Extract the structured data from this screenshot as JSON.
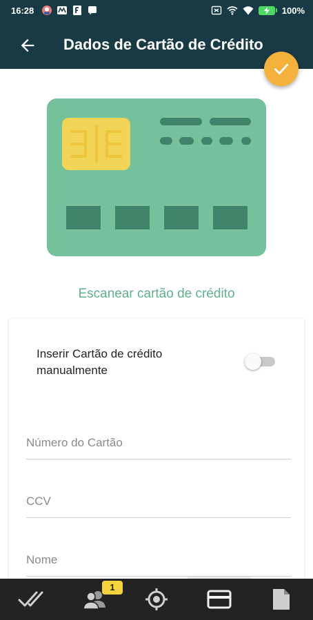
{
  "status_bar": {
    "time": "16:28",
    "battery": "100%",
    "icons_left": [
      "avatar-icon",
      "mail-icon",
      "news-icon",
      "chat-icon"
    ],
    "icons_right": [
      "nfc-icon",
      "wifi-hotspot-icon",
      "wifi-icon",
      "battery-icon"
    ]
  },
  "app_bar": {
    "title": "Dados de Cartão de Crédito",
    "back_icon": "arrow-left-icon",
    "fab_icon": "check-icon"
  },
  "card_illustration": {
    "icon": "credit-card-illustration",
    "colors": {
      "card": "#74c19c",
      "chip": "#f2d556",
      "details": "#3f8469"
    }
  },
  "scan_link": "Escanear cartão de crédito",
  "form": {
    "manual_label": "Inserir Cartão de crédito manualmente",
    "manual_toggle_on": false,
    "fields": [
      {
        "placeholder": "Número do Cartão",
        "value": ""
      },
      {
        "placeholder": "CCV",
        "value": ""
      },
      {
        "placeholder": "Nome",
        "value": ""
      }
    ]
  },
  "bottom_nav": {
    "items": [
      "double-check-icon",
      "group-icon",
      "location-target-icon",
      "credit-card-icon",
      "document-icon"
    ],
    "active": "credit-card-icon",
    "badge": "1"
  },
  "colors": {
    "primary": "#173a44",
    "accent": "#f4b23a",
    "link": "#5fb08d",
    "nav_bg": "#232323"
  }
}
